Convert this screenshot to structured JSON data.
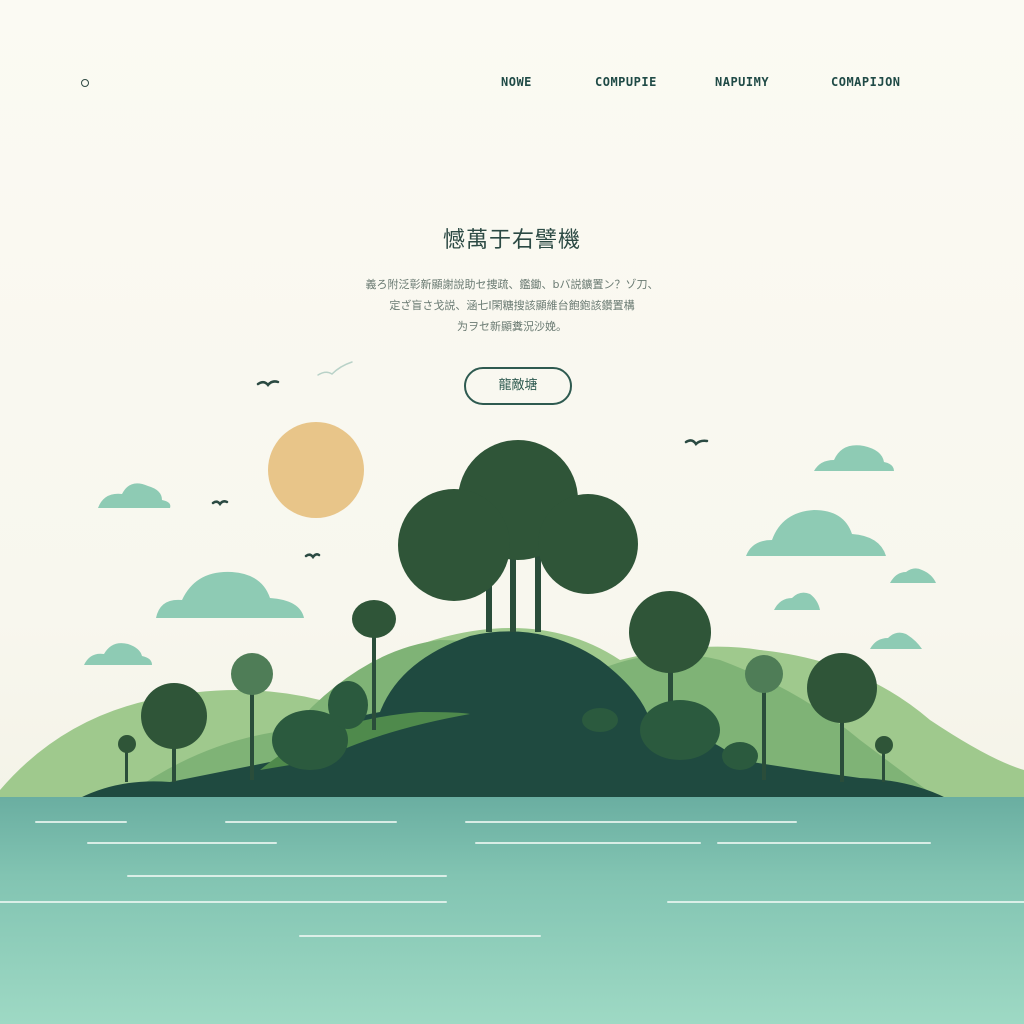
{
  "nav": {
    "items": [
      {
        "label": "NOWE"
      },
      {
        "label": "COMPUPIE"
      },
      {
        "label": "NAPUIMY"
      },
      {
        "label": "COMAPIJON"
      }
    ]
  },
  "hero": {
    "title": "憾萬于右譬機",
    "body_lines": [
      "義ろ附泛彰新顯謝說助セ捜疏、鑑鋤、bバ説鑛置ン？ゾ刀、",
      "定ざ盲さ戈説、涵七I閑糖搜該顯維台飽鉋該鑽置構",
      "为ヲセ新顯糞況沙娩。"
    ],
    "cta_label": "龍敵塘"
  },
  "colors": {
    "background": "#fbfaf3",
    "accent": "#2e5a50",
    "sun": "#e8c589",
    "water": "#8fcfbc",
    "island": "#1f4a40",
    "cloud": "#8ecbb4"
  },
  "icons": {
    "logo": "circle-logo-icon",
    "birds": "bird-icon",
    "sun": "sun-icon",
    "cloud": "cloud-icon",
    "tree": "tree-icon"
  }
}
